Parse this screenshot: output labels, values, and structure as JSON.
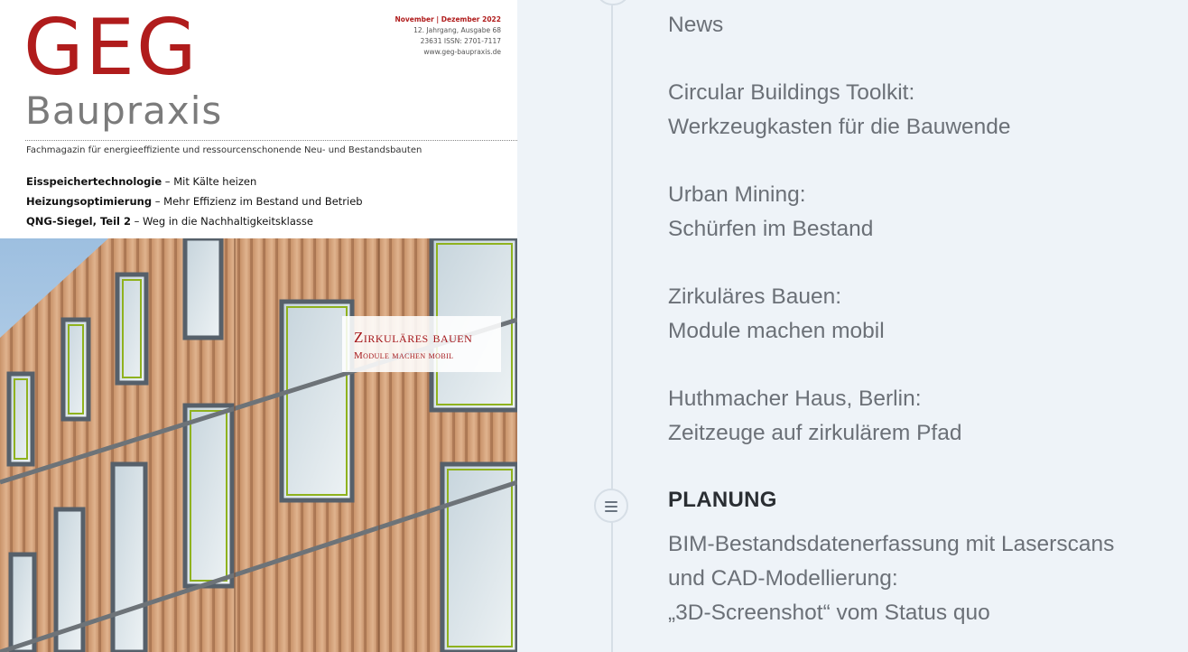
{
  "cover": {
    "logo_top": "GEG",
    "logo_bottom": "Baupraxis",
    "issue_date": "November | Dezember 2022",
    "issue_volume": "12. Jahrgang, Ausgabe 68",
    "issue_numbers": "23631 ISSN: 2701-7117",
    "issue_url": "www.geg-baupraxis.de",
    "tagline": "Fachmagazin für energieeffiziente und ressourcenschonende Neu- und Bestandsbauten",
    "topics": [
      {
        "bold": "Eisspeichertechnologie",
        "rest": " – Mit Kälte heizen"
      },
      {
        "bold": "Heizungsoptimierung",
        "rest": " – Mehr Effizienz im Bestand und Betrieb"
      },
      {
        "bold": "QNG-Siegel, Teil 2",
        "rest": " – Weg in die Nachhaltigkeitsklasse"
      }
    ],
    "badge_title": "Zirkuläres bauen",
    "badge_subtitle": "Module machen mobil",
    "brand_red": "#b01c1c"
  },
  "toc": {
    "items": [
      {
        "lines": [
          "News"
        ]
      },
      {
        "lines": [
          "Circular Buildings Toolkit:",
          "Werkzeugkasten für die Bauwende"
        ]
      },
      {
        "lines": [
          "Urban Mining:",
          "Schürfen im Bestand"
        ]
      },
      {
        "lines": [
          "Zirkuläres Bauen:",
          "Module machen mobil"
        ]
      },
      {
        "lines": [
          "Huthmacher Haus, Berlin:",
          "Zeitzeuge auf zirkulärem Pfad"
        ]
      }
    ],
    "section_heading": "PLANUNG",
    "section_icon": "list-icon",
    "section_items": [
      {
        "lines": [
          "BIM-Bestandsdatenerfassung mit Laserscans",
          "und CAD-Modellierung:",
          "„3D-Screenshot“ vom Status quo"
        ]
      }
    ]
  }
}
